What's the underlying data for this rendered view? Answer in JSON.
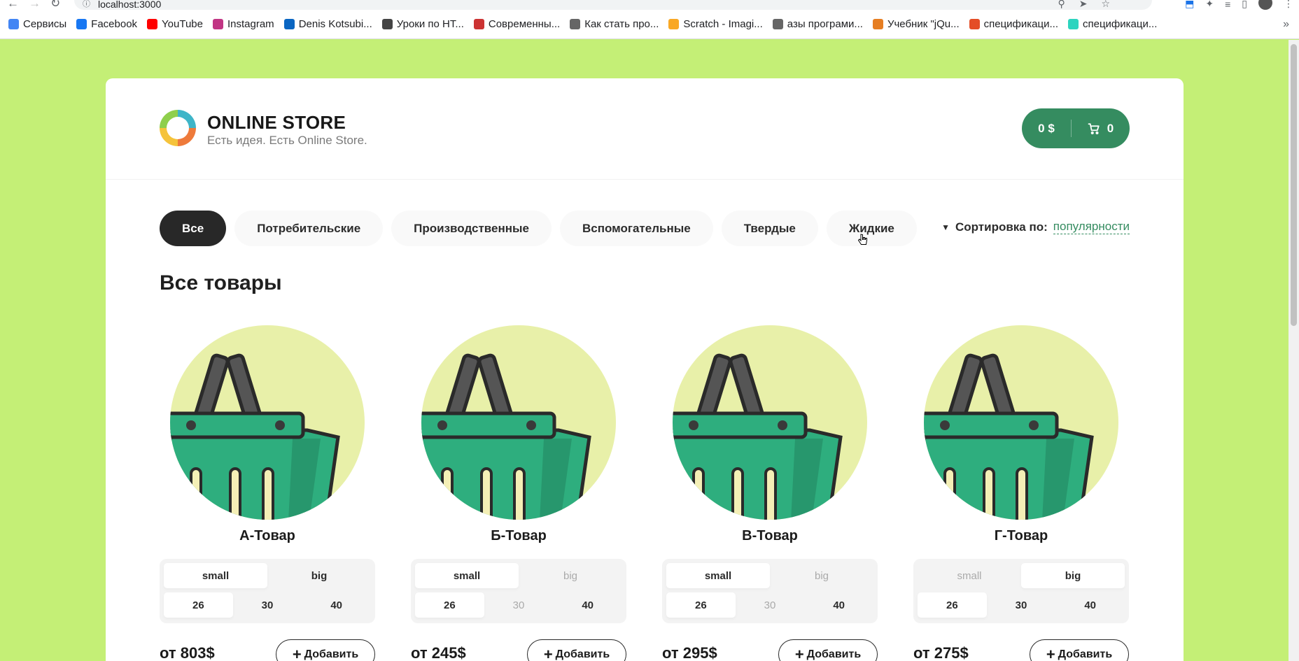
{
  "browser": {
    "url": "localhost:3000",
    "bookmarks": [
      {
        "label": "Сервисы",
        "color": "#4285f4"
      },
      {
        "label": "Facebook",
        "color": "#1877f2"
      },
      {
        "label": "YouTube",
        "color": "#ff0000"
      },
      {
        "label": "Instagram",
        "color": "#c13584"
      },
      {
        "label": "Denis Kotsubi...",
        "color": "#0a66c2"
      },
      {
        "label": "Уроки по НТ...",
        "color": "#444444"
      },
      {
        "label": "Современны...",
        "color": "#cc3333"
      },
      {
        "label": "Как стать про...",
        "color": "#666666"
      },
      {
        "label": "Scratch - Imagi...",
        "color": "#f9a825"
      },
      {
        "label": "азы програми...",
        "color": "#666666"
      },
      {
        "label": "Учебник \"jQu...",
        "color": "#e67e22"
      },
      {
        "label": "спецификаци...",
        "color": "#e44d26"
      },
      {
        "label": "спецификаци...",
        "color": "#2dd4bf"
      }
    ]
  },
  "header": {
    "brand_title": "ONLINE STORE",
    "brand_subtitle": "Есть идея. Есть Online Store.",
    "cart_price": "0 $",
    "cart_count": "0"
  },
  "categories": [
    "Все",
    "Потребительские",
    "Производственные",
    "Вспомогательные",
    "Твердые",
    "Жидкие"
  ],
  "active_category": "Все",
  "sort": {
    "label": "Сортировка по:",
    "value": "популярности"
  },
  "title": "Все товары",
  "products": [
    {
      "name": "А-Товар",
      "types": [
        {
          "label": "small",
          "state": "sel"
        },
        {
          "label": "big",
          "state": "on"
        }
      ],
      "sizes": [
        {
          "label": "26",
          "state": "sel"
        },
        {
          "label": "30",
          "state": "on"
        },
        {
          "label": "40",
          "state": "on"
        }
      ],
      "price": "от 803$",
      "add": "Добавить"
    },
    {
      "name": "Б-Товар",
      "types": [
        {
          "label": "small",
          "state": "sel"
        },
        {
          "label": "big",
          "state": "dis"
        }
      ],
      "sizes": [
        {
          "label": "26",
          "state": "sel"
        },
        {
          "label": "30",
          "state": "dis"
        },
        {
          "label": "40",
          "state": "on"
        }
      ],
      "price": "от 245$",
      "add": "Добавить"
    },
    {
      "name": "В-Товар",
      "types": [
        {
          "label": "small",
          "state": "sel"
        },
        {
          "label": "big",
          "state": "dis"
        }
      ],
      "sizes": [
        {
          "label": "26",
          "state": "sel"
        },
        {
          "label": "30",
          "state": "dis"
        },
        {
          "label": "40",
          "state": "on"
        }
      ],
      "price": "от 295$",
      "add": "Добавить"
    },
    {
      "name": "Г-Товар",
      "types": [
        {
          "label": "small",
          "state": "dis"
        },
        {
          "label": "big",
          "state": "sel"
        }
      ],
      "sizes": [
        {
          "label": "26",
          "state": "sel"
        },
        {
          "label": "30",
          "state": "on"
        },
        {
          "label": "40",
          "state": "on"
        }
      ],
      "price": "от 275$",
      "add": "Добавить"
    }
  ],
  "colors": {
    "page_bg": "#c4ef76",
    "accent": "#358c60",
    "dark": "#282828",
    "image_bg": "#e8f0a9",
    "basket": "#2eae7e"
  },
  "icons": {
    "cart": "cart-icon",
    "sort": "triangle-down-icon",
    "add": "plus-icon",
    "product": "basket-icon"
  }
}
